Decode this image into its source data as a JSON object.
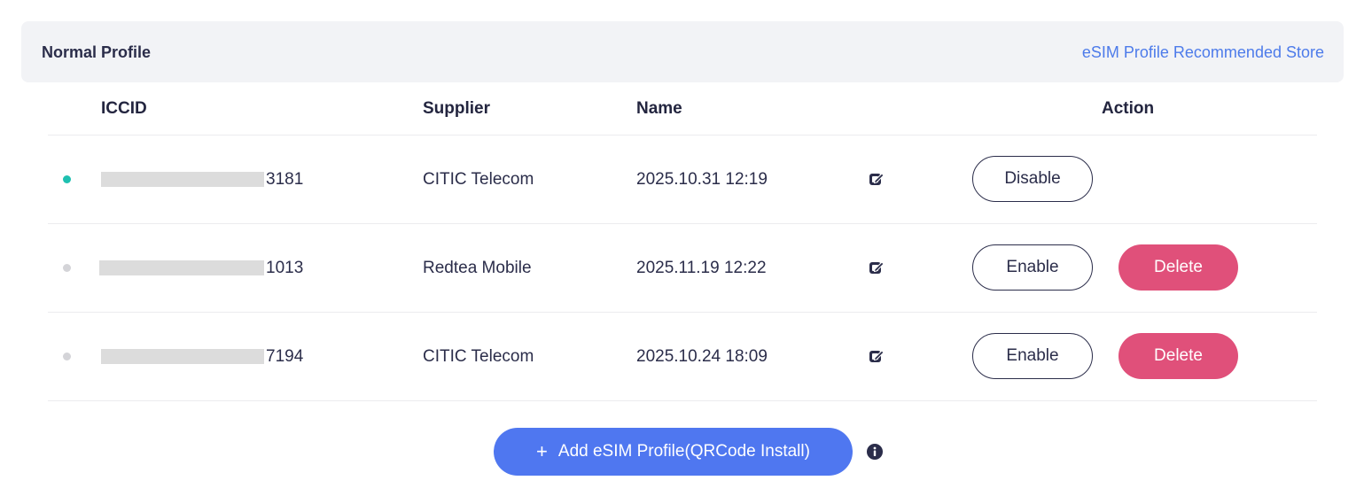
{
  "header": {
    "section_title": "Normal Profile",
    "store_link": "eSIM Profile Recommended Store"
  },
  "table": {
    "columns": {
      "iccid": "ICCID",
      "supplier": "Supplier",
      "name": "Name",
      "action": "Action"
    },
    "rows": [
      {
        "status": "active",
        "status_color": "#1ec0b0",
        "iccid_suffix": "3181",
        "supplier": "CITIC Telecom",
        "name": "2025.10.31 12:19",
        "primary_action": "Disable"
      },
      {
        "status": "inactive",
        "status_color": "#d4d4d8",
        "iccid_suffix": "1013",
        "supplier": "Redtea Mobile",
        "name": "2025.11.19 12:22",
        "primary_action": "Enable",
        "secondary_action": "Delete"
      },
      {
        "status": "inactive",
        "status_color": "#d4d4d8",
        "iccid_suffix": "7194",
        "supplier": "CITIC Telecom",
        "name": "2025.10.24 18:09",
        "primary_action": "Enable",
        "secondary_action": "Delete"
      }
    ]
  },
  "footer": {
    "add_plus": "+",
    "add_label": "Add eSIM Profile(QRCode Install)",
    "info_icon": "info-icon"
  },
  "colors": {
    "accent_blue": "#4f77f0",
    "link_blue": "#4d7bea",
    "delete_pink": "#e0507a",
    "active_teal": "#1ec0b0"
  }
}
